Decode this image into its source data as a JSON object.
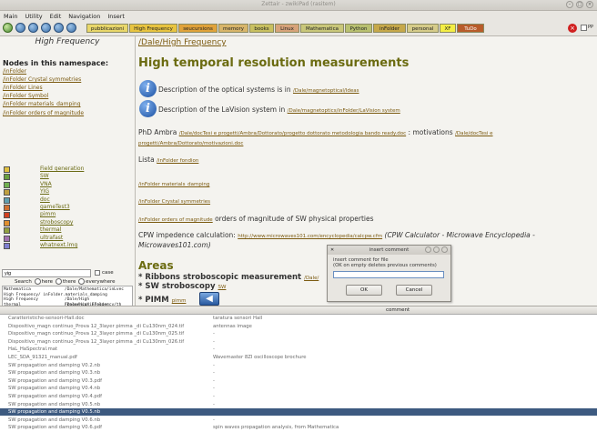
{
  "window": {
    "title": "Zettair - zwikiPad (rasitem)"
  },
  "menu": [
    "Main",
    "Utility",
    "Edit",
    "Navigation",
    "Insert"
  ],
  "tabs": [
    {
      "label": "pubblicazioni",
      "color": "#e9d76a"
    },
    {
      "label": "High Frequency",
      "color": "#e8c440"
    },
    {
      "label": "seucursions",
      "color": "#e0a23a"
    },
    {
      "label": "memory",
      "color": "#d8b56a"
    },
    {
      "label": "books",
      "color": "#c8c060"
    },
    {
      "label": "Linux",
      "color": "#d7a37a"
    },
    {
      "label": "Mathematica",
      "color": "#c9c77a"
    },
    {
      "label": "Python",
      "color": "#b8c070"
    },
    {
      "label": "inFolder",
      "color": "#c6a84a"
    },
    {
      "label": "personal",
      "color": "#d6cc8a"
    },
    {
      "label": "XF",
      "color": "#f4ee44"
    },
    {
      "label": "TuDo",
      "color": "#b85c2a"
    }
  ],
  "toolbar": {
    "pp_label": "PP"
  },
  "left": {
    "title": "High Frequency",
    "nodes_heading": "Nodes in this namespace:",
    "namespace_links": [
      "/inFolder",
      "/inFolder Crystal symmetries",
      "/inFolder Lines",
      "/inFolder Symbol",
      "/inFolder materials_damping",
      "/inFolder orders of magnitude"
    ],
    "children": [
      {
        "label": "Field generation",
        "color": "#e0c040"
      },
      {
        "label": "SW",
        "color": "#6aa040"
      },
      {
        "label": "VNA",
        "color": "#70b050"
      },
      {
        "label": "YIG",
        "color": "#c0a040"
      },
      {
        "label": "doc",
        "color": "#60a0b0"
      },
      {
        "label": "gameTest3",
        "color": "#d07030"
      },
      {
        "label": "pimm",
        "color": "#d04020"
      },
      {
        "label": "stroboscopy",
        "color": "#e09030"
      },
      {
        "label": "thermal",
        "color": "#90a040"
      },
      {
        "label": "ultrafast",
        "color": "#a070b0"
      },
      {
        "label": "whatnext.lmg",
        "color": "#8080d0"
      }
    ],
    "search": {
      "value": "yig",
      "case_label": "case",
      "search_label": "Search",
      "opt_here": "here",
      "opt_there": "there",
      "opt_everywhere": "everywhere"
    },
    "results": [
      [
        "Mathematica",
        "/Dale/Mathematica/inLvec"
      ],
      [
        "High Frequency/ inFolder.materials_damping",
        ""
      ],
      [
        "High Frequency",
        "/Dale/High Frequency/inFolder"
      ],
      [
        "thermal",
        "/Dale/High Frequency/th"
      ],
      [
        "pimm",
        "/Dale/High Frequency/SW/pim"
      ],
      [
        "SW",
        "/Dale/High Frequency/SW/PIMM"
      ],
      [
        "VNA",
        "/Dale/High Frequency/vna"
      ],
      [
        "stroboscopy",
        "/Dale/High Frequency/SW/str"
      ]
    ]
  },
  "main": {
    "path": "/Dale/High Frequency",
    "heading": "High temporal resolution measurements",
    "opt_text": "Description of the optical systems is in",
    "opt_link": "/Dale/magnetoptical/Ideas",
    "lav_text": "Description of the LaVision system in",
    "lav_link": "/Dale/magnetoptics/inFolder/LaVision system",
    "phd_text": "PhD Ambra",
    "phd_link": "/Dale/docTesi e progetti/Ambra/Dottorato/progetto dottorato metodologia bando ready.doc",
    "phd_text2": ": motivations",
    "phd_link2": "/Dale/docTesi e progetti/Ambra/Dottorato/motivazioni.doc",
    "lista_text": "Lista",
    "lista_link": "/inFolder fondion",
    "links": [
      "/inFolder materials_damping",
      "/inFolder Crystal symmetries",
      "/inFolder orders of magnitude"
    ],
    "orders_text": "orders of magnitude of SW physical properties",
    "cpw_text": "CPW impedence calculation:",
    "cpw_link": "http://www.microwaves101.com/encyclopedia/calcpw.cfm",
    "cpw_ital": "(CPW Calculator - Microwave Encyclopedia - Microwaves101.com)",
    "areas": "Areas",
    "bullet1": "* Ribbons stroboscopic measurement",
    "bullet1_link": "/Dale/",
    "bullet2": "* SW stroboscopy",
    "bullet2_link": "SW",
    "bullet3": "* PIMM",
    "bullet3_link": "pimm"
  },
  "dialog": {
    "title": "insert comment",
    "line1": "insert comment for file",
    "line2": "(OK on empty deletes previous comments)",
    "ok": "OK",
    "cancel": "Cancel"
  },
  "table": {
    "col_comment": "comment",
    "selected_index": 12,
    "rows": [
      [
        "Caratteristiche-sensori-Hall.doc",
        "taratura sensori Hall"
      ],
      [
        "Dispositivo_magn continuo_Prova 12_3layer pimma _di Cu130nm_024.tif",
        "antennas image"
      ],
      [
        "Dispositivo_magn continuo_Prova 12_3layer pimma _di Cu130nm_025.tif",
        "-"
      ],
      [
        "Dispositivo_magn continuo_Prova 12_3layer pimma _di Cu130nm_026.tif",
        "-"
      ],
      [
        "HaL_HaSpectral.mat",
        "-"
      ],
      [
        "LEC_SDA_91321_manual.pdf",
        "Wavemaster 8ZI oscilloscope brochure"
      ],
      [
        "SW propagation and damping V0.2.nb",
        "-"
      ],
      [
        "SW propagation and damping V0.3.nb",
        "-"
      ],
      [
        "SW propagation and damping V0.3.pdf",
        "-"
      ],
      [
        "SW propagation and damping V0.4.nb",
        "-"
      ],
      [
        "SW propagation and damping V0.4.pdf",
        "-"
      ],
      [
        "SW propagation and damping V0.5.nb",
        "-"
      ],
      [
        "SW propagation and damping V0.5.nb",
        ""
      ],
      [
        "SW propagation and damping V0.6.nb",
        "-"
      ],
      [
        "SW propagation and damping V0.6.pdf",
        "spin waves propagation analysis, from Mathematica"
      ]
    ]
  }
}
